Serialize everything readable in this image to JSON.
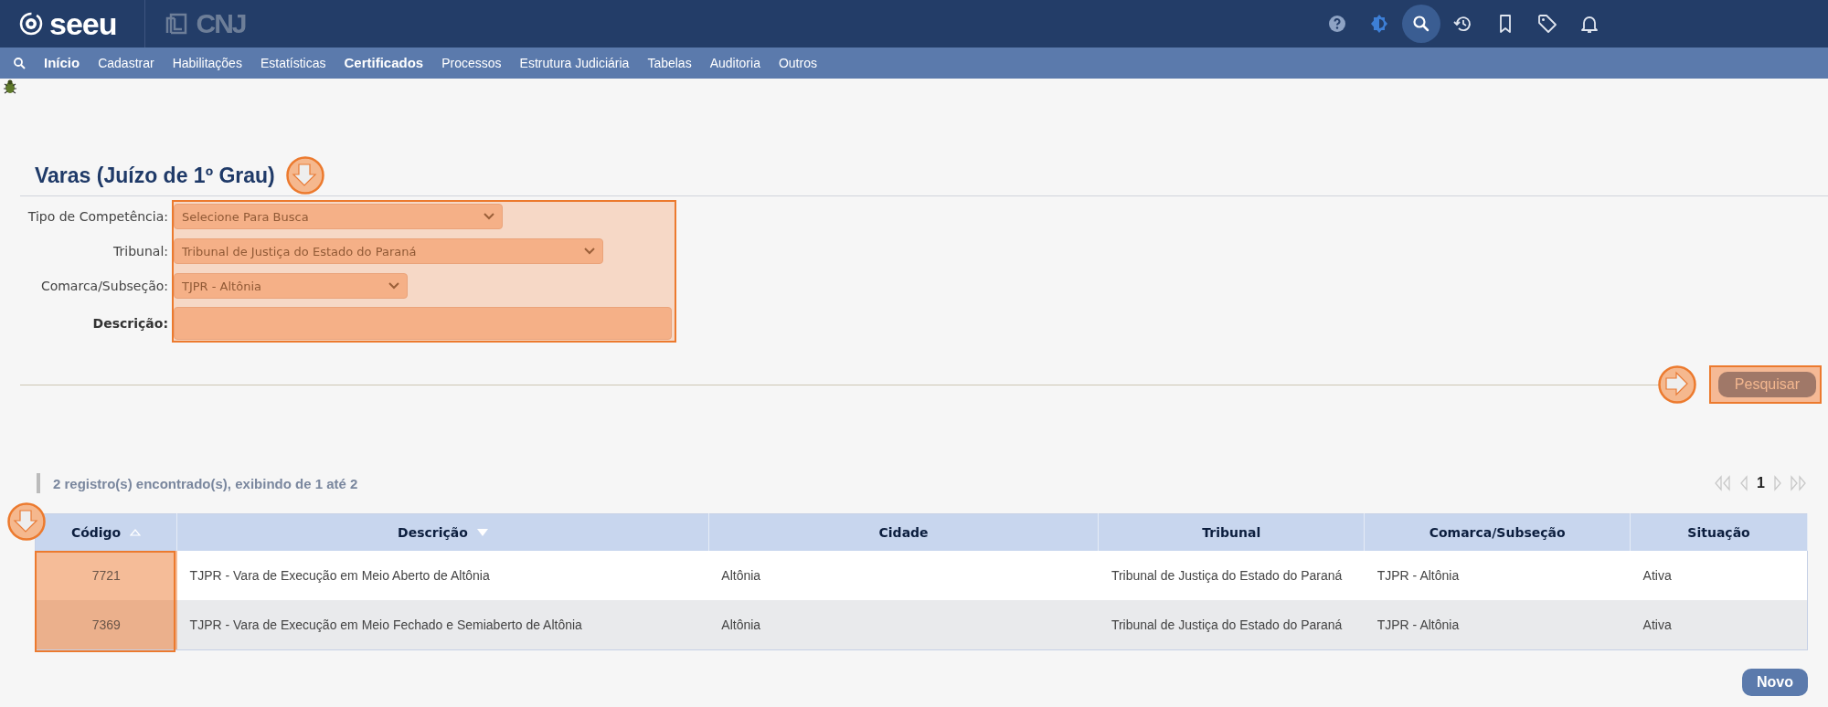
{
  "header": {
    "logo": "seeu",
    "partner": "CNJ",
    "icons": [
      {
        "kind": "help",
        "selected": false
      },
      {
        "kind": "contrast",
        "selected": false
      },
      {
        "kind": "search",
        "selected": true
      },
      {
        "kind": "history",
        "selected": false
      },
      {
        "kind": "bookmark",
        "selected": false
      },
      {
        "kind": "tag",
        "selected": false
      },
      {
        "kind": "bell",
        "selected": false
      }
    ]
  },
  "nav": {
    "items": [
      {
        "label": "Início",
        "emphasized": true
      },
      {
        "label": "Cadastrar",
        "emphasized": false
      },
      {
        "label": "Habilitações",
        "emphasized": false
      },
      {
        "label": "Estatísticas",
        "emphasized": false
      },
      {
        "label": "Certificados",
        "emphasized": true
      },
      {
        "label": "Processos",
        "emphasized": false
      },
      {
        "label": "Estrutura Judiciária",
        "emphasized": false
      },
      {
        "label": "Tabelas",
        "emphasized": false
      },
      {
        "label": "Auditoria",
        "emphasized": false
      },
      {
        "label": "Outros",
        "emphasized": false
      }
    ]
  },
  "page_title": "Varas (Juízo de 1º Grau)",
  "form": {
    "fields": [
      {
        "kind": "select",
        "label": "Tipo de Competência:",
        "value": "Selecione Para Busca",
        "bold_label": false
      },
      {
        "kind": "select",
        "label": "Tribunal:",
        "value": "Tribunal de Justiça do Estado do Paraná",
        "bold_label": false
      },
      {
        "kind": "select",
        "label": "Comarca/Subseção:",
        "value": "TJPR - Altônia",
        "bold_label": false
      },
      {
        "kind": "text",
        "label": "Descrição:",
        "bold_label": true
      }
    ]
  },
  "search_button": "Pesquisar",
  "results": {
    "summary": "2 registro(s) encontrado(s), exibindo de 1 até 2",
    "page": "1"
  },
  "table": {
    "columns": [
      {
        "label": "Código",
        "sorted_ascending": true,
        "sorted_descending": false
      },
      {
        "label": "Descrição",
        "sorted_ascending": false,
        "sorted_descending": true
      },
      {
        "label": "Cidade",
        "sorted_ascending": false,
        "sorted_descending": false
      },
      {
        "label": "Tribunal",
        "sorted_ascending": false,
        "sorted_descending": false
      },
      {
        "label": "Comarca/Subseção",
        "sorted_ascending": false,
        "sorted_descending": false
      },
      {
        "label": "Situação",
        "sorted_ascending": false,
        "sorted_descending": false
      }
    ],
    "rows": [
      [
        "7721",
        "TJPR - Vara de Execução em Meio Aberto de Altônia",
        "Altônia",
        "Tribunal de Justiça do Estado do Paraná",
        "TJPR - Altônia",
        "Ativa"
      ],
      [
        "7369",
        "TJPR - Vara de Execução em Meio Fechado e Semiaberto de Altônia",
        "Altônia",
        "Tribunal de Justiça do Estado do Paraná",
        "TJPR - Altônia",
        "Ativa"
      ]
    ]
  },
  "new_button": "Novo"
}
